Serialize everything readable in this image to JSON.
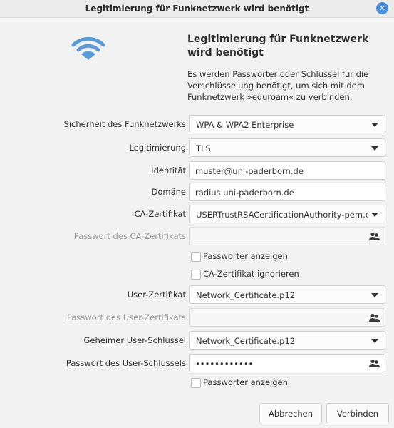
{
  "window": {
    "title": "Legitimierung für Funknetzwerk wird benötigt"
  },
  "header": {
    "title": "Legitimierung für Funknetzwerk wird benötigt",
    "description": "Es werden Passwörter oder Schlüssel für die Verschlüsselung benötigt, um sich mit dem Funknetzwerk »eduroam« zu verbinden."
  },
  "form": {
    "security": {
      "label": "Sicherheit des Funknetzwerks",
      "value": "WPA & WPA2 Enterprise"
    },
    "authentication": {
      "label": "Legitimierung",
      "value": "TLS"
    },
    "identity": {
      "label": "Identität",
      "value": "muster@uni-paderborn.de"
    },
    "domain": {
      "label": "Domäne",
      "value": "radius.uni-paderborn.de"
    },
    "ca_cert": {
      "label": "CA-Zertifikat",
      "value": "USERTrustRSACertificationAuthority-pem.crt"
    },
    "ca_cert_password": {
      "label": "Passwort des CA-Zertifikats",
      "value": ""
    },
    "show_passwords_1": {
      "label": "Passwörter anzeigen",
      "checked": false
    },
    "ignore_ca_cert": {
      "label": "CA-Zertifikat ignorieren",
      "checked": false
    },
    "user_cert": {
      "label": "User-Zertifikat",
      "value": "Network_Certificate.p12"
    },
    "user_cert_password": {
      "label": "Passwort des User-Zertifikats",
      "value": ""
    },
    "private_key": {
      "label": "Geheimer User-Schlüssel",
      "value": "Network_Certificate.p12"
    },
    "private_key_password": {
      "label": "Passwort des User-Schlüssels",
      "value": "••••••••••••"
    },
    "show_passwords_2": {
      "label": "Passwörter anzeigen",
      "checked": false
    }
  },
  "buttons": {
    "cancel": "Abbrechen",
    "connect": "Verbinden"
  },
  "colors": {
    "accent": "#4a90d9",
    "wifi": "#5b9bd5"
  },
  "icons": {
    "network": "wifi-icon",
    "close": "close-icon",
    "password": "users-icon",
    "dropdown": "chevron-down-icon"
  }
}
